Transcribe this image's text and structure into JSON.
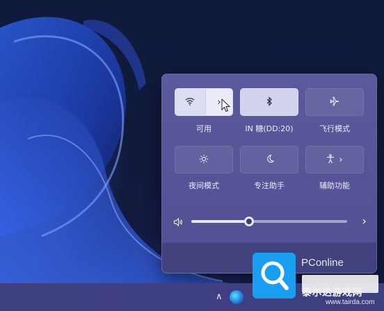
{
  "quick_settings": {
    "tiles": [
      {
        "id": "wifi",
        "label": "可用",
        "icon": "wifi-icon",
        "active": true,
        "has_chevron": true
      },
      {
        "id": "bluetooth",
        "label": "IN 糖(DD:20)",
        "icon": "bluetooth-icon",
        "active": true
      },
      {
        "id": "airplane",
        "label": "飞行模式",
        "icon": "airplane-icon",
        "active": false
      },
      {
        "id": "night-light",
        "label": "夜间模式",
        "icon": "brightness-icon",
        "active": false
      },
      {
        "id": "focus",
        "label": "专注助手",
        "icon": "moon-icon",
        "active": false
      },
      {
        "id": "accessibility",
        "label": "辅助功能",
        "icon": "accessibility-icon",
        "active": false,
        "has_chevron": true
      }
    ],
    "volume": {
      "icon": "speaker-icon",
      "level": 0.37
    }
  },
  "watermark": {
    "brand": "PConline",
    "site_cn": "泰尔达游戏网",
    "url": "www.tairda.com"
  },
  "colors": {
    "accent_tile": "#d2d2ee",
    "flyout_bg": "#5a5a9c",
    "watermark_blue": "#1a9ff0"
  }
}
